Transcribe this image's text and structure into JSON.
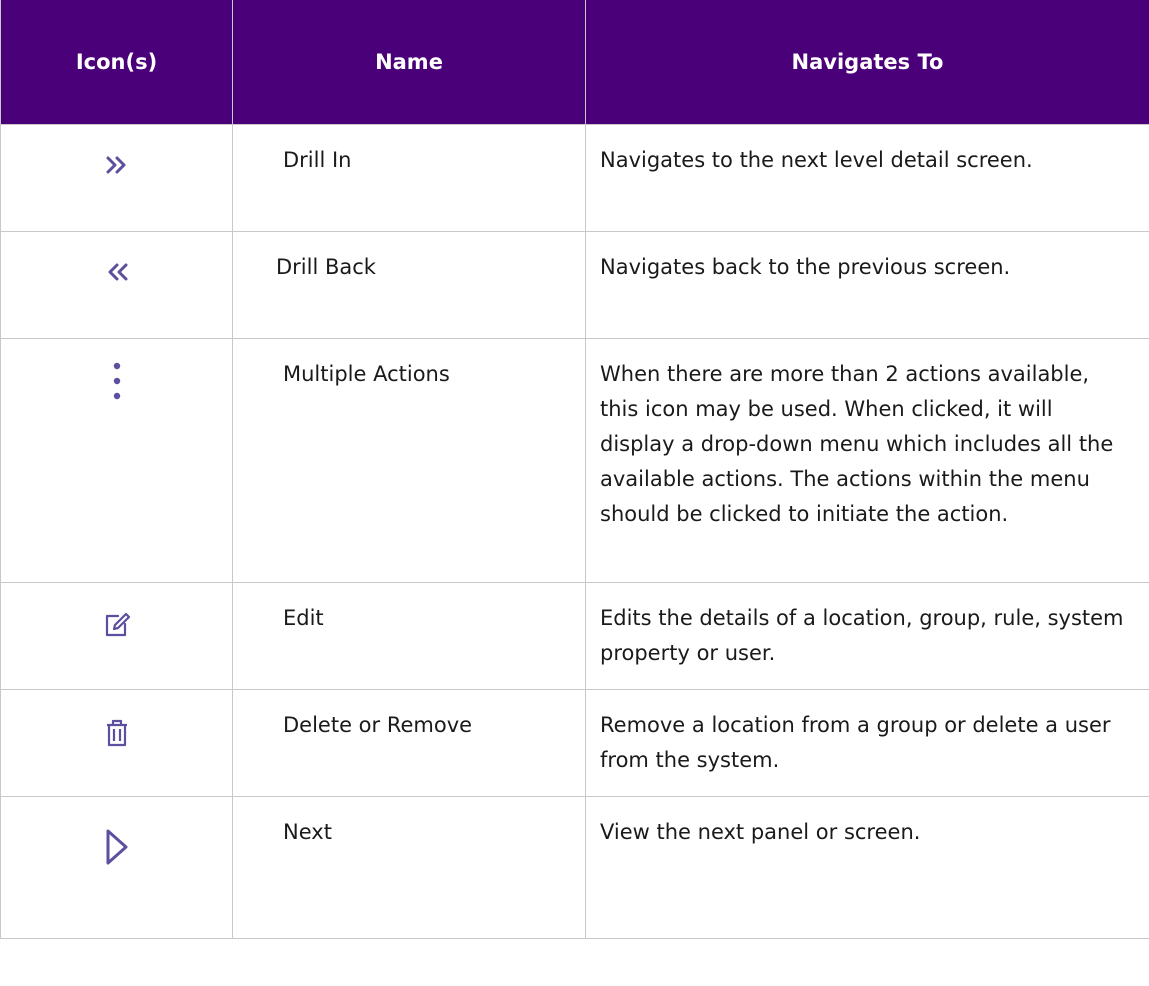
{
  "headers": {
    "icons": "Icon(s)",
    "name": "Name",
    "navigates_to": "Navigates To"
  },
  "colors": {
    "header_bg": "#4a0078",
    "icon": "#5b4fa0"
  },
  "rows": [
    {
      "icon": "double-chevron-right-icon",
      "name": "Drill In",
      "description": "Navigates to the next level detail screen."
    },
    {
      "icon": "double-chevron-left-icon",
      "name": "Drill Back",
      "description": "Navigates back to the previous screen."
    },
    {
      "icon": "vertical-ellipsis-icon",
      "name": "Multiple Actions",
      "description": "When there are more than 2 actions available, this icon may be used. When clicked, it will display a drop-down menu which includes all the available actions. The actions within the menu should be clicked to initiate the action."
    },
    {
      "icon": "edit-icon",
      "name": "Edit",
      "description": "Edits the details of a location, group, rule, system property or user."
    },
    {
      "icon": "trash-icon",
      "name": "Delete or Remove",
      "description": "Remove a location from a group or delete a user from the system."
    },
    {
      "icon": "play-outline-icon",
      "name": "Next",
      "description": "View the next panel or screen."
    }
  ]
}
